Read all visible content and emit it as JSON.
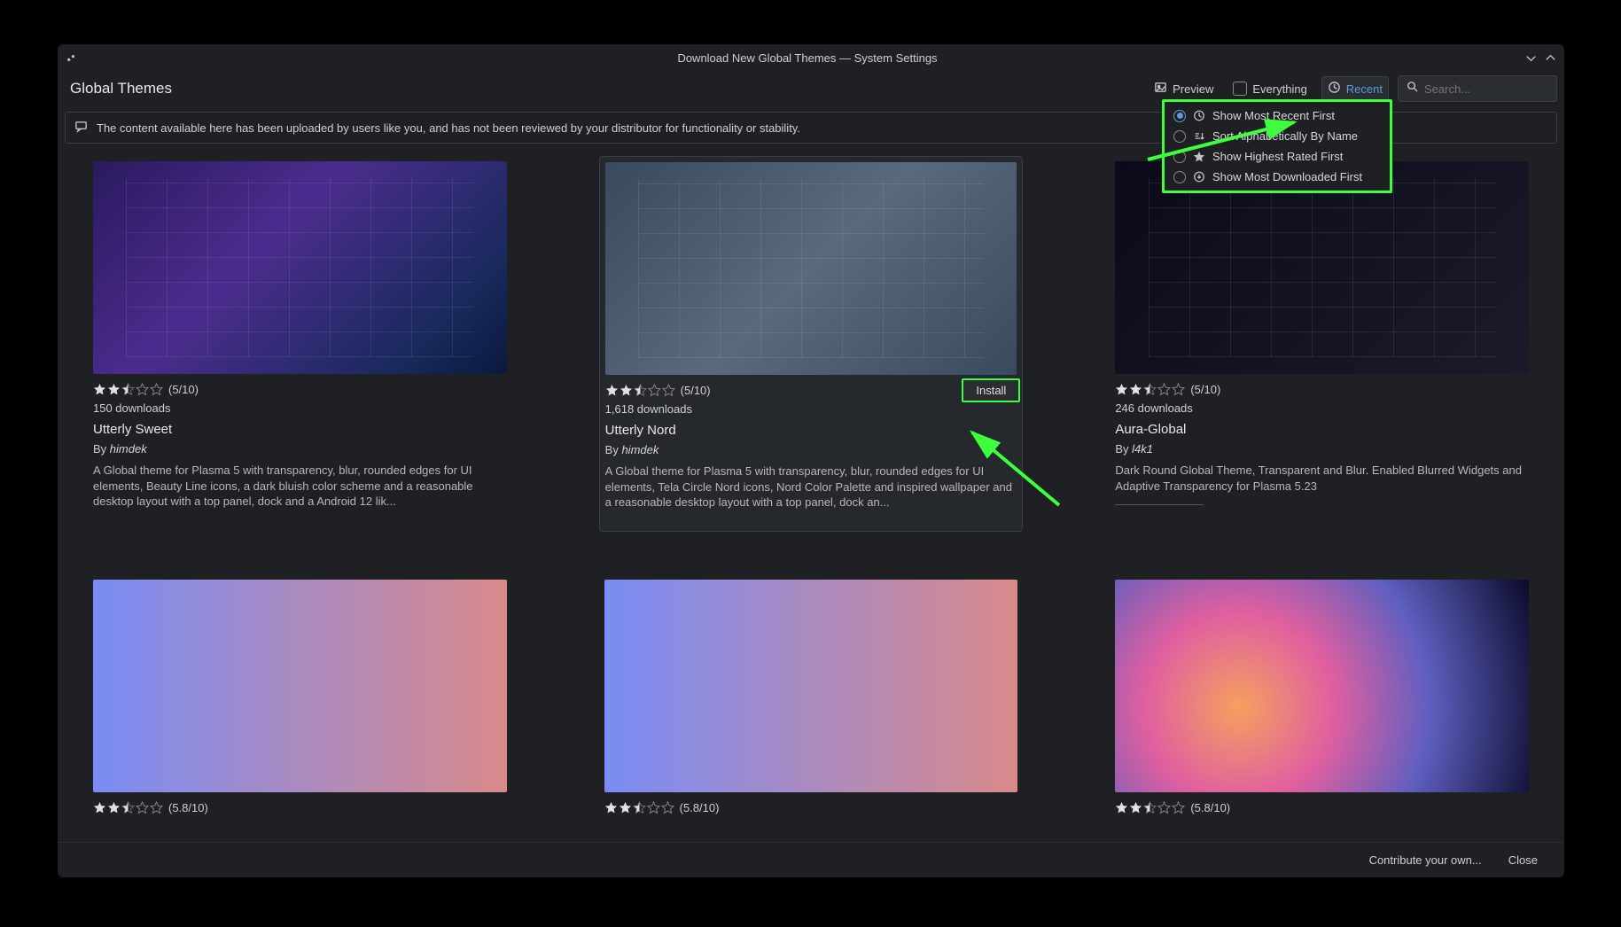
{
  "window": {
    "title": "Download New Global Themes — System Settings"
  },
  "toolbar": {
    "page_title": "Global Themes",
    "preview_label": "Preview",
    "everything_label": "Everything",
    "recent_label": "Recent",
    "search_placeholder": "Search..."
  },
  "info_bar": "The content available here has been uploaded by users like you, and has not been reviewed by your distributor for functionality or stability.",
  "sort_menu": {
    "items": [
      {
        "label": "Show Most Recent First",
        "icon": "clock",
        "selected": true
      },
      {
        "label": "Sort Alphabetically By Name",
        "icon": "sort-az",
        "selected": false
      },
      {
        "label": "Show Highest Rated First",
        "icon": "star",
        "selected": false
      },
      {
        "label": "Show Most Downloaded First",
        "icon": "download",
        "selected": false
      }
    ]
  },
  "themes": [
    {
      "name": "Utterly Sweet",
      "author": "himdek",
      "rating": "(5/10)",
      "stars": 2.5,
      "downloads": "150 downloads",
      "desc": "A Global theme for Plasma 5 with transparency, blur, rounded edges for UI elements, Beauty Line icons, a dark bluish color scheme and a reasonable desktop layout with a top panel, dock and a Android 12 lik..."
    },
    {
      "name": "Utterly Nord",
      "author": "himdek",
      "rating": "(5/10)",
      "stars": 2.5,
      "downloads": "1,618 downloads",
      "desc": "A Global theme for Plasma 5 with transparency, blur, rounded edges for UI elements, Tela Circle Nord icons, Nord Color Palette and inspired wallpaper and a reasonable desktop layout with a top panel, dock an...",
      "selected": true,
      "install": "Install"
    },
    {
      "name": "Aura-Global",
      "author": "l4k1",
      "rating": "(5/10)",
      "stars": 2.5,
      "downloads": "246 downloads",
      "desc": "Dark Round Global Theme, Transparent and Blur. Enabled Blurred Widgets and Adaptive Transparency for Plasma 5.23"
    },
    {
      "name": "",
      "rating": "(5.8/10)",
      "stars": 2.5
    },
    {
      "name": "",
      "rating": "(5.8/10)",
      "stars": 2.5
    },
    {
      "name": "",
      "rating": "(5.8/10)",
      "stars": 2.5
    }
  ],
  "footer": {
    "contribute": "Contribute your own...",
    "close": "Close"
  }
}
